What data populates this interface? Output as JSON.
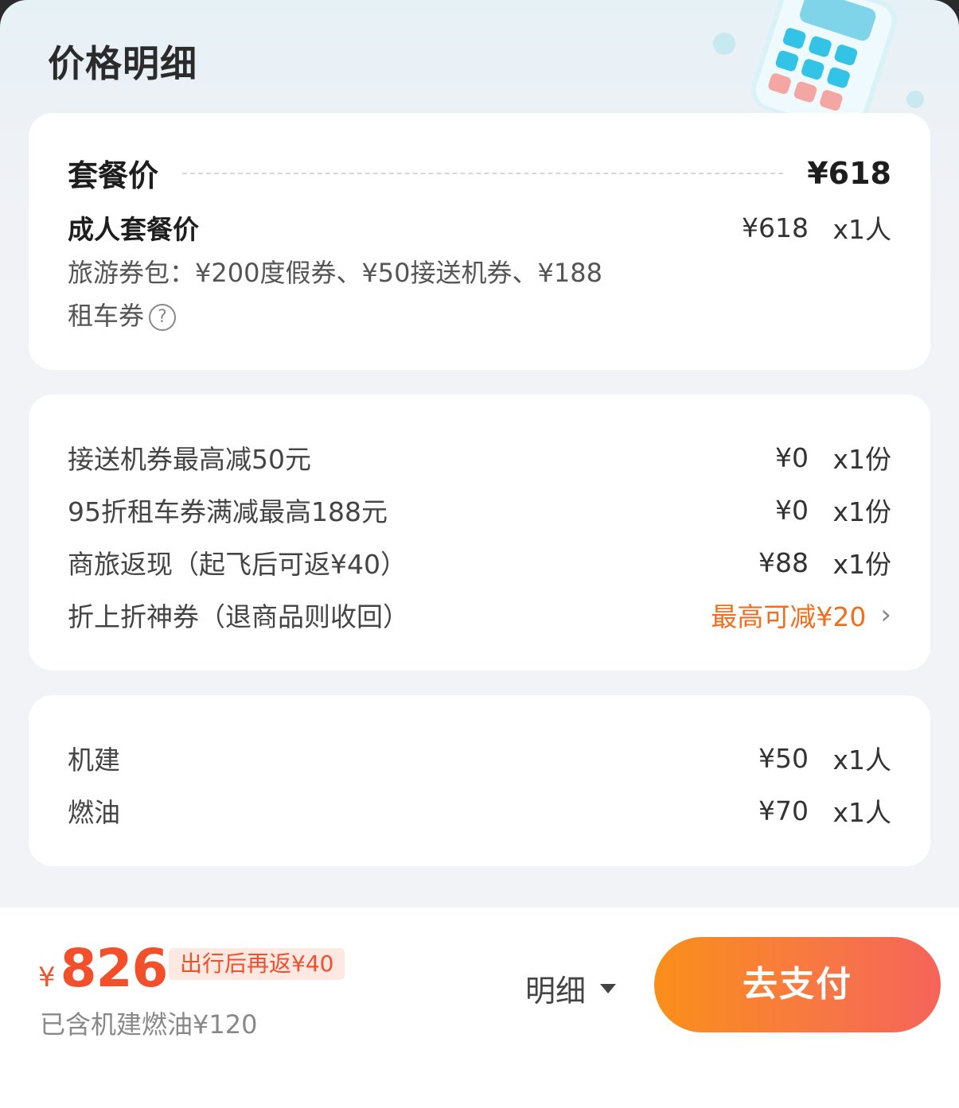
{
  "title": "价格明细",
  "package": {
    "label": "套餐价",
    "price": "¥618",
    "adult": {
      "label": "成人套餐价",
      "price": "¥618",
      "qty": "x1人"
    },
    "voucher_line1": "旅游券包：¥200度假券、¥50接送机券、¥188",
    "voucher_line2": "租车券",
    "help_icon": "help-circle-icon"
  },
  "benefits": [
    {
      "label": "接送机券最高减50元",
      "price": "¥0",
      "qty": "x1份"
    },
    {
      "label": "95折租车券满减最高188元",
      "price": "¥0",
      "qty": "x1份"
    },
    {
      "label": "商旅返现（起飞后可返¥40）",
      "price": "¥88",
      "qty": "x1份"
    },
    {
      "label": "折上折神券（退商品则收回）",
      "price": "最高可减¥20",
      "chevron": "›"
    }
  ],
  "taxes": [
    {
      "label": "机建",
      "price": "¥50",
      "qty": "x1人"
    },
    {
      "label": "燃油",
      "price": "¥70",
      "qty": "x1人"
    }
  ],
  "footer": {
    "currency": "¥",
    "total": "826",
    "cashback_badge": "出行后再返¥40",
    "included_note": "已含机建燃油¥120",
    "detail_label": "明细",
    "pay_label": "去支付"
  },
  "colors": {
    "accent_orange": "#f06e1d",
    "price_red": "#f2502a",
    "pay_gradient_start": "#fa8f1a",
    "pay_gradient_end": "#f5645a"
  },
  "decor": {
    "illustration": "calculator-icon"
  }
}
